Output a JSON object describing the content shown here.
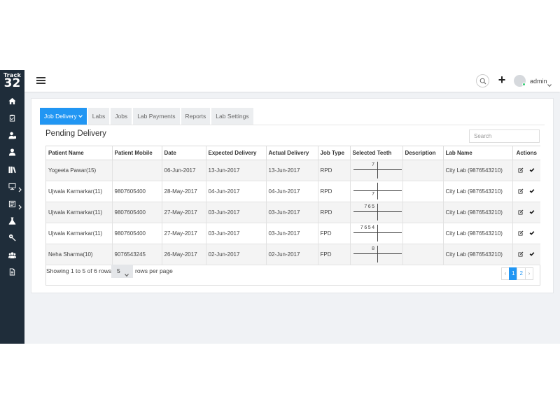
{
  "app": {
    "logo_line1": "Track",
    "logo_line2": "32",
    "user_name": "admin",
    "accent_color": "#2196f3",
    "sidebar_color": "#1f2d3a"
  },
  "sidebar": {
    "items": [
      {
        "icon": "home-icon"
      },
      {
        "icon": "clipboard-check-icon"
      },
      {
        "icon": "user-tie-icon"
      },
      {
        "icon": "user-icon"
      },
      {
        "icon": "books-icon"
      },
      {
        "icon": "monitor-icon",
        "has_submenu": true
      },
      {
        "icon": "list-icon",
        "has_submenu": true
      },
      {
        "icon": "flask-icon"
      },
      {
        "icon": "tools-icon"
      },
      {
        "icon": "users-icon"
      },
      {
        "icon": "document-icon"
      }
    ]
  },
  "tabs": [
    {
      "label": "Job Delivery",
      "active": true,
      "has_dropdown": true
    },
    {
      "label": "Labs"
    },
    {
      "label": "Jobs"
    },
    {
      "label": "Lab Payments"
    },
    {
      "label": "Reports"
    },
    {
      "label": "Lab Settings"
    }
  ],
  "section": {
    "title": "Pending Delivery",
    "search_placeholder": "Search"
  },
  "table": {
    "columns": [
      "Patient Name",
      "Patient Mobile",
      "Date",
      "Expected Delivery",
      "Actual Delivery",
      "Job Type",
      "Selected Teeth",
      "Description",
      "Lab Name",
      "Actions"
    ],
    "rows": [
      {
        "name": "Yogeeta Pawar(15)",
        "mobile": "",
        "date": "06-Jun-2017",
        "expected": "13-Jun-2017",
        "actual": "13-Jun-2017",
        "job_type": "RPD",
        "teeth_upper_left": "7",
        "teeth_lower_left": "",
        "description": "",
        "lab": "City Lab (9876543210)"
      },
      {
        "name": "Ujwala Karmarkar(11)",
        "mobile": "9807605400",
        "date": "28-May-2017",
        "expected": "04-Jun-2017",
        "actual": "04-Jun-2017",
        "job_type": "RPD",
        "teeth_upper_left": "",
        "teeth_lower_left": "7",
        "description": "",
        "lab": "City Lab (9876543210)"
      },
      {
        "name": "Ujwala Karmarkar(11)",
        "mobile": "9807605400",
        "date": "27-May-2017",
        "expected": "03-Jun-2017",
        "actual": "03-Jun-2017",
        "job_type": "RPD",
        "teeth_upper_left": "765",
        "teeth_lower_left": "",
        "description": "",
        "lab": "City Lab (9876543210)"
      },
      {
        "name": "Ujwala Karmarkar(11)",
        "mobile": "9807605400",
        "date": "27-May-2017",
        "expected": "03-Jun-2017",
        "actual": "03-Jun-2017",
        "job_type": "FPD",
        "teeth_upper_left": "7654",
        "teeth_lower_left": "",
        "description": "",
        "lab": "City Lab (9876543210)"
      },
      {
        "name": "Neha Sharma(10)",
        "mobile": "9076543245",
        "date": "26-May-2017",
        "expected": "02-Jun-2017",
        "actual": "02-Jun-2017",
        "job_type": "FPD",
        "teeth_upper_left": "8",
        "teeth_lower_left": "",
        "description": "",
        "lab": "City Lab (9876543210)"
      }
    ]
  },
  "footer": {
    "showing_text": "Showing 1 to 5 of 6 rows",
    "page_size": "5",
    "rows_per_page_text": "rows per page",
    "prev": "‹",
    "next": "›",
    "pages": [
      "1",
      "2"
    ],
    "current_page": "1"
  }
}
